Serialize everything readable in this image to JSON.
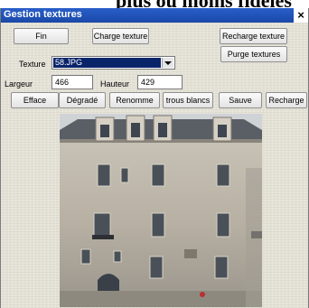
{
  "heading": {
    "text": "plus ou moins fidèles"
  },
  "window": {
    "title": "Gestion textures",
    "close_glyph": "×"
  },
  "toolbar": {
    "fin": "Fin",
    "charge_texture": "Charge texture",
    "recharge_texture": "Recharge texture",
    "purge_textures": "Purge textures"
  },
  "texture": {
    "label": "Texture",
    "selected": "58.JPG"
  },
  "size": {
    "width_label": "Largeur",
    "width_value": "466",
    "height_label": "Hauteur",
    "height_value": "429"
  },
  "actions": {
    "efface": "Efface",
    "degrade": "Dégradé",
    "renomme": "Renomme",
    "trous_blancs": "trous blancs",
    "sauve": "Sauve",
    "recharge": "Recharge"
  },
  "colors": {
    "titlebar": "#1f52b6",
    "selection": "#0a246a",
    "panel": "#e4e1d6"
  }
}
